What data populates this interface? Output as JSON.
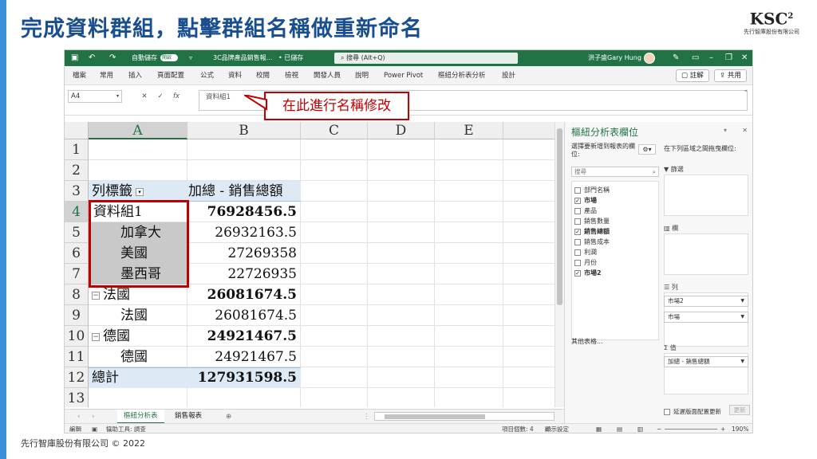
{
  "slide": {
    "title": "完成資料群組，點擊群組名稱做重新命名",
    "logo_mark": "KSC",
    "logo_sup": "2",
    "logo_text": "先行智庫股份有限公司",
    "footer": "先行智庫股份有限公司 © 2022"
  },
  "titlebar": {
    "autosave_label": "自動儲存",
    "autosave_state": "開啟",
    "filename": "3C品牌產品銷售報...",
    "saved_status": "• 已儲存",
    "search_placeholder": "搜尋 (Alt+Q)",
    "user_name": "洪子盛Gary Hung"
  },
  "ribbon": {
    "tabs": [
      "檔案",
      "常用",
      "插入",
      "頁面配置",
      "公式",
      "資料",
      "校閱",
      "檢視",
      "開發人員",
      "說明",
      "Power Pivot",
      "樞紐分析表分析",
      "設計"
    ],
    "comment_button": "註解",
    "share_button": "共用"
  },
  "formula_bar": {
    "name_box": "A4",
    "content": "資料組1"
  },
  "callout": {
    "text": "在此進行名稱修改"
  },
  "sheet": {
    "columns": [
      "A",
      "B",
      "C",
      "D",
      "E",
      "F"
    ],
    "rows": [
      "1",
      "2",
      "3",
      "4",
      "5",
      "6",
      "7",
      "8",
      "9",
      "10",
      "11",
      "12",
      "13"
    ],
    "header_row": {
      "label": "列標籤",
      "value_label": "加總 - 銷售總額"
    },
    "pivot_rows": [
      {
        "label": "資料組1",
        "value": "76928456.5",
        "level": 0
      },
      {
        "label": "加拿大",
        "value": "26932163.5",
        "level": 1
      },
      {
        "label": "美國",
        "value": "27269358",
        "level": 1
      },
      {
        "label": "墨西哥",
        "value": "22726935",
        "level": 1
      },
      {
        "label": "法國",
        "value": "26081674.5",
        "level": 0
      },
      {
        "label": "法國",
        "value": "26081674.5",
        "level": 1
      },
      {
        "label": "德國",
        "value": "24921467.5",
        "level": 0
      },
      {
        "label": "德國",
        "value": "24921467.5",
        "level": 1
      }
    ],
    "total_row": {
      "label": "總計",
      "value": "127931598.5"
    }
  },
  "sheet_tabs": [
    "樞紐分析表",
    "銷售報表"
  ],
  "statusbar": {
    "mode": "編輯",
    "accessibility": "協助工具: 調查",
    "count": "項目個數: 4",
    "display_settings": "顯示設定",
    "zoom": "190%"
  },
  "pivot_pane": {
    "title": "樞紐分析表欄位",
    "choose_fields": "選擇要新增到報表的欄位:",
    "drag_areas": "在下列區域之間拖曳欄位:",
    "search_placeholder": "搜尋",
    "fields": [
      {
        "name": "部門名稱",
        "checked": false
      },
      {
        "name": "市場",
        "checked": true
      },
      {
        "name": "產品",
        "checked": false
      },
      {
        "name": "銷售數量",
        "checked": false
      },
      {
        "name": "銷售總額",
        "checked": true
      },
      {
        "name": "銷售成本",
        "checked": false
      },
      {
        "name": "利潤",
        "checked": false
      },
      {
        "name": "月份",
        "checked": false
      },
      {
        "name": "市場2",
        "checked": true
      }
    ],
    "more_tables": "其他表格...",
    "filters_label": "篩選",
    "columns_label": "欄",
    "rows_label": "列",
    "values_label": "值",
    "row_items": [
      "市場2",
      "市場"
    ],
    "value_items": [
      "加總 - 銷售總額"
    ],
    "defer_update": "延遲版面配置更新",
    "update_button": "更新"
  }
}
